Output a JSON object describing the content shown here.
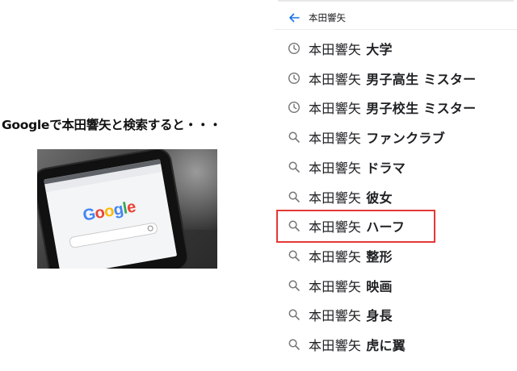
{
  "left": {
    "caption": "Googleで本田響矢と検索すると・・・",
    "photo": {
      "screen_logo_letters": [
        "G",
        "o",
        "o",
        "g",
        "l",
        "e"
      ],
      "logo_colors": [
        "#4285F4",
        "#EA4335",
        "#FBBC05",
        "#4285F4",
        "#34A853",
        "#EA4335"
      ]
    }
  },
  "search": {
    "back_icon": "arrow-left-icon",
    "query": "本田響矢",
    "accent": "#1a73e8"
  },
  "suggestions": [
    {
      "icon": "history-clock-icon",
      "base": "本田響矢",
      "suffix": "大学"
    },
    {
      "icon": "history-clock-icon",
      "base": "本田響矢",
      "suffix": "男子高生 ミスター"
    },
    {
      "icon": "history-clock-icon",
      "base": "本田響矢",
      "suffix": "男子校生 ミスター"
    },
    {
      "icon": "search-icon",
      "base": "本田響矢",
      "suffix": "ファンクラブ"
    },
    {
      "icon": "search-icon",
      "base": "本田響矢",
      "suffix": "ドラマ"
    },
    {
      "icon": "search-icon",
      "base": "本田響矢",
      "suffix": "彼女"
    },
    {
      "icon": "search-icon",
      "base": "本田響矢",
      "suffix": "ハーフ"
    },
    {
      "icon": "search-icon",
      "base": "本田響矢",
      "suffix": "整形"
    },
    {
      "icon": "search-icon",
      "base": "本田響矢",
      "suffix": "映画"
    },
    {
      "icon": "search-icon",
      "base": "本田響矢",
      "suffix": "身長"
    },
    {
      "icon": "search-icon",
      "base": "本田響矢",
      "suffix": "虎に翼"
    }
  ],
  "highlight_color": "#e53935"
}
